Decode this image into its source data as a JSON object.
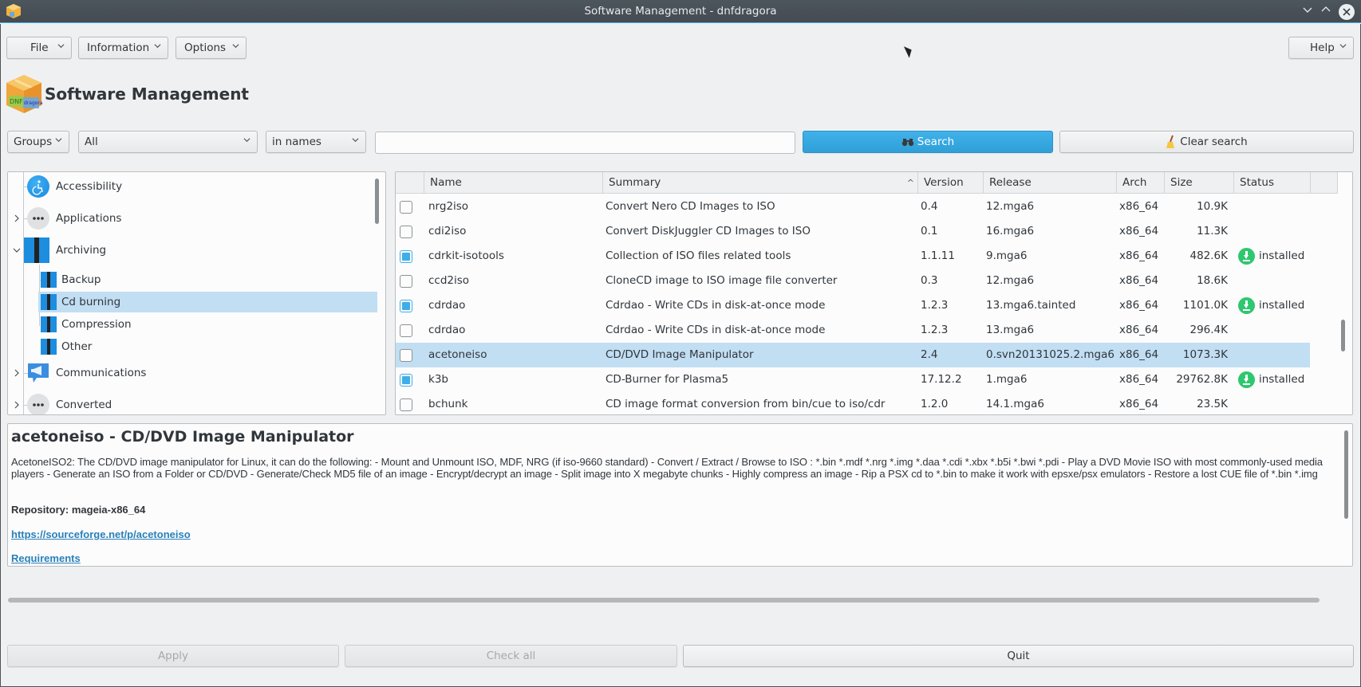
{
  "window": {
    "title": "Software Management - dnfdragora",
    "controls": {
      "minimize": "⌄",
      "maximize": "⌃",
      "close": "✕"
    }
  },
  "menubar": {
    "file": "File",
    "information": "Information",
    "options": "Options",
    "help": "Help"
  },
  "header": {
    "title": "Software Management"
  },
  "filters": {
    "view_mode": "Groups",
    "package_filter": "All",
    "search_field": "in names",
    "search_value": "",
    "search_placeholder": "",
    "search_button": "Search",
    "clear_button": "Clear search"
  },
  "tree": {
    "items": [
      {
        "label": "Accessibility",
        "icon": "accessibility-icon",
        "expandable": false
      },
      {
        "label": "Applications",
        "icon": "more-icon",
        "expandable": true,
        "expanded": false
      },
      {
        "label": "Archiving",
        "icon": "archive-icon",
        "expandable": true,
        "expanded": true,
        "children": [
          {
            "label": "Backup"
          },
          {
            "label": "Cd burning",
            "selected": true
          },
          {
            "label": "Compression"
          },
          {
            "label": "Other"
          }
        ]
      },
      {
        "label": "Communications",
        "icon": "communications-icon",
        "expandable": true,
        "expanded": false
      },
      {
        "label": "Converted",
        "icon": "more-icon",
        "expandable": true,
        "expanded": false
      }
    ]
  },
  "table": {
    "columns": [
      "",
      "Name",
      "Summary",
      "Version",
      "Release",
      "Arch",
      "Size",
      "Status",
      ""
    ],
    "sort_column": "Summary",
    "sort_direction": "ascending",
    "rows": [
      {
        "checked": false,
        "name": "nrg2iso",
        "summary": "Convert Nero CD Images to ISO",
        "version": "0.4",
        "release": "12.mga6",
        "arch": "x86_64",
        "size": "10.9K",
        "status": ""
      },
      {
        "checked": false,
        "name": "cdi2iso",
        "summary": "Convert DiskJuggler CD Images to ISO",
        "version": "0.1",
        "release": "16.mga6",
        "arch": "x86_64",
        "size": "11.3K",
        "status": ""
      },
      {
        "checked": true,
        "name": "cdrkit-isotools",
        "summary": "Collection of ISO files related tools",
        "version": "1.1.11",
        "release": "9.mga6",
        "arch": "x86_64",
        "size": "482.6K",
        "status": "installed"
      },
      {
        "checked": false,
        "name": "ccd2iso",
        "summary": "CloneCD image to ISO image file converter",
        "version": "0.3",
        "release": "12.mga6",
        "arch": "x86_64",
        "size": "18.6K",
        "status": ""
      },
      {
        "checked": true,
        "name": "cdrdao",
        "summary": "Cdrdao - Write CDs in disk-at-once mode",
        "version": "1.2.3",
        "release": "13.mga6.tainted",
        "arch": "x86_64",
        "size": "1101.0K",
        "status": "installed"
      },
      {
        "checked": false,
        "name": "cdrdao",
        "summary": "Cdrdao - Write CDs in disk-at-once mode",
        "version": "1.2.3",
        "release": "13.mga6",
        "arch": "x86_64",
        "size": "296.4K",
        "status": ""
      },
      {
        "checked": false,
        "name": "acetoneiso",
        "summary": "CD/DVD Image Manipulator",
        "version": "2.4",
        "release": "0.svn20131025.2.mga6",
        "arch": "x86_64",
        "size": "1073.3K",
        "status": "",
        "selected": true
      },
      {
        "checked": true,
        "name": "k3b",
        "summary": "CD-Burner for Plasma5",
        "version": "17.12.2",
        "release": "1.mga6",
        "arch": "x86_64",
        "size": "29762.8K",
        "status": "installed"
      },
      {
        "checked": false,
        "name": "bchunk",
        "summary": "CD image format conversion from bin/cue to iso/cdr",
        "version": "1.2.0",
        "release": "14.1.mga6",
        "arch": "x86_64",
        "size": "23.5K",
        "status": ""
      }
    ]
  },
  "info": {
    "title": "acetoneiso - CD/DVD Image Manipulator",
    "description": "AcetoneISO2: The CD/DVD image manipulator for Linux, it can do the following: - Mount and Unmount ISO, MDF, NRG (if iso-9660 standard) - Convert / Extract / Browse to ISO : *.bin *.mdf *.nrg *.img *.daa *.cdi *.xbx *.b5i *.bwi *.pdi - Play a DVD Movie ISO with most commonly-used media players - Generate an ISO from a Folder or CD/DVD - Generate/Check MD5 file of an image - Encrypt/decrypt an image - Split image into X megabyte chunks - Highly compress an image - Rip a PSX cd to *.bin to make it work with epsxe/psx emulators - Restore a lost CUE file of *.bin *.img",
    "repository": "Repository: mageia-x86_64",
    "url": "https://sourceforge.net/p/acetoneiso",
    "requirements": "Requirements"
  },
  "footer": {
    "apply": "Apply",
    "check_all": "Check all",
    "quit": "Quit"
  },
  "colors": {
    "accent": "#3daee9",
    "selection": "#c1def3",
    "installed": "#2fc76f",
    "link": "#2980b9"
  }
}
